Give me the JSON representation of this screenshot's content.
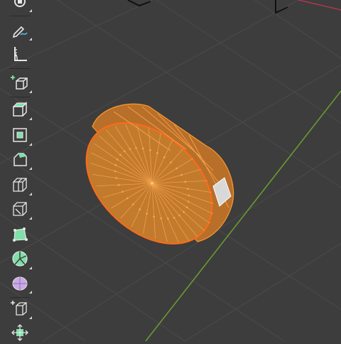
{
  "viewport": {
    "background": "#3d3d3d",
    "grid_color": "#4a4a4a",
    "y_axis_color": "#6c9a2e",
    "x_axis_color": "#b5394a",
    "selection_fill": "#c77a2a",
    "selection_edge": "#ff9a2a",
    "active_edge": "#ff6a1a",
    "active_face": "#e8e8e8"
  },
  "toolbar": {
    "tools": [
      {
        "name": "transform",
        "icon": "transform-icon"
      },
      {
        "name": "annotate",
        "icon": "annotate-pencil-icon"
      },
      {
        "name": "measure",
        "icon": "measure-ruler-icon"
      },
      {
        "name": "add-cube",
        "icon": "add-cube-icon"
      },
      {
        "name": "extrude-region",
        "icon": "extrude-region-icon"
      },
      {
        "name": "inset-faces",
        "icon": "inset-faces-icon"
      },
      {
        "name": "bevel",
        "icon": "bevel-icon"
      },
      {
        "name": "loop-cut",
        "icon": "loop-cut-icon"
      },
      {
        "name": "knife",
        "icon": "knife-icon"
      },
      {
        "name": "poly-build",
        "icon": "poly-build-icon"
      },
      {
        "name": "spin",
        "icon": "spin-icon"
      },
      {
        "name": "smooth",
        "icon": "smooth-vertices-icon"
      },
      {
        "name": "edge-slide",
        "icon": "edge-slide-icon"
      },
      {
        "name": "shrink-fatten",
        "icon": "shrink-fatten-icon"
      }
    ]
  }
}
